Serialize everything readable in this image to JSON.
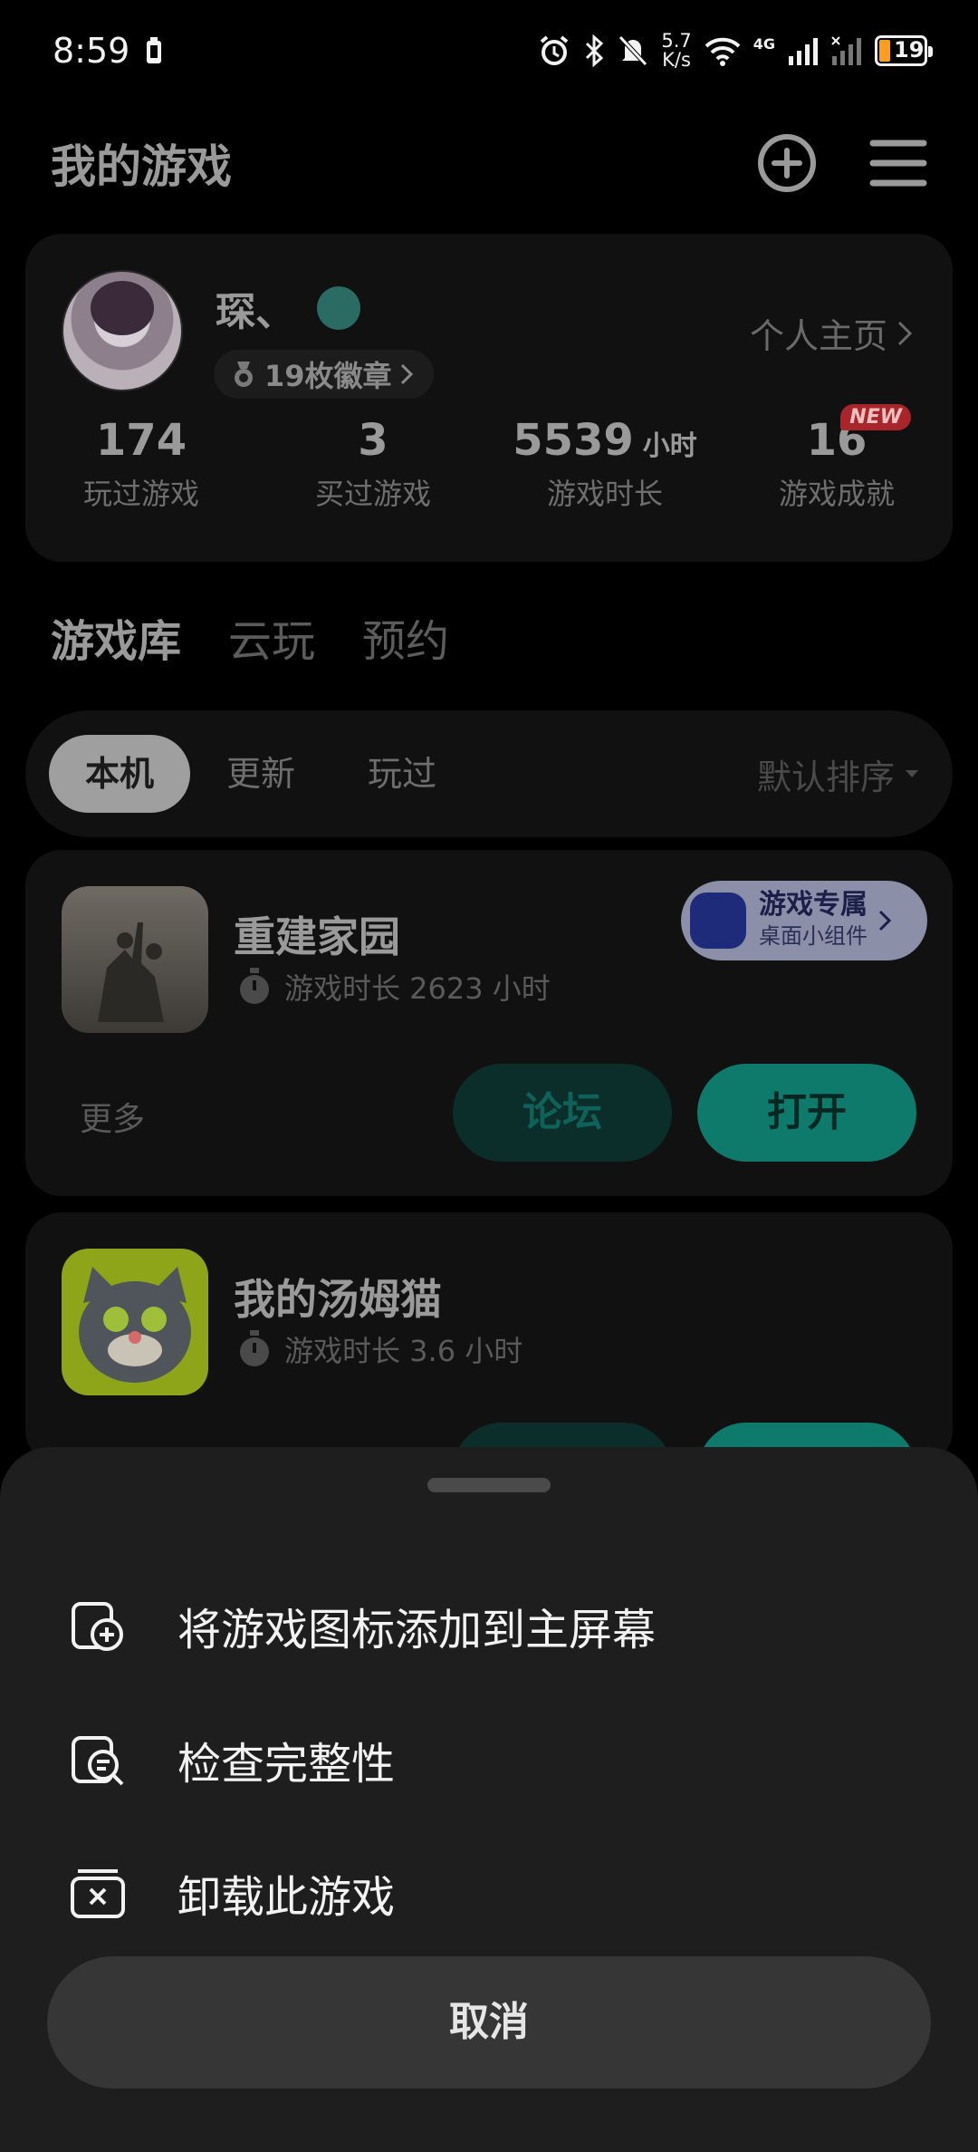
{
  "status_bar": {
    "time": "8:59",
    "net_speed_value": "5.7",
    "net_speed_unit": "K/s",
    "network_label": "4G",
    "battery": "19"
  },
  "header": {
    "title": "我的游戏"
  },
  "profile": {
    "username": "琛、",
    "badges": "19枚徽章",
    "homepage_link": "个人主页",
    "stats": [
      {
        "value": "174",
        "unit": "",
        "label": "玩过游戏"
      },
      {
        "value": "3",
        "unit": "",
        "label": "买过游戏"
      },
      {
        "value": "5539",
        "unit": "小时",
        "label": "游戏时长"
      },
      {
        "value": "16",
        "unit": "",
        "label": "游戏成就",
        "tag": "NEW"
      }
    ]
  },
  "tabs": [
    "游戏库",
    "云玩",
    "预约"
  ],
  "filters": {
    "chips": [
      "本机",
      "更新",
      "玩过"
    ],
    "sort": "默认排序"
  },
  "games": [
    {
      "name": "重建家园",
      "playtime": "游戏时长 2623 小时",
      "widget_title": "游戏专属",
      "widget_sub": "桌面小组件",
      "more": "更多",
      "forum": "论坛",
      "open": "打开"
    },
    {
      "name": "我的汤姆猫",
      "playtime": "游戏时长 3.6 小时"
    }
  ],
  "sheet": {
    "options": [
      "将游戏图标添加到主屏幕",
      "检查完整性",
      "卸载此游戏"
    ],
    "cancel": "取消"
  }
}
